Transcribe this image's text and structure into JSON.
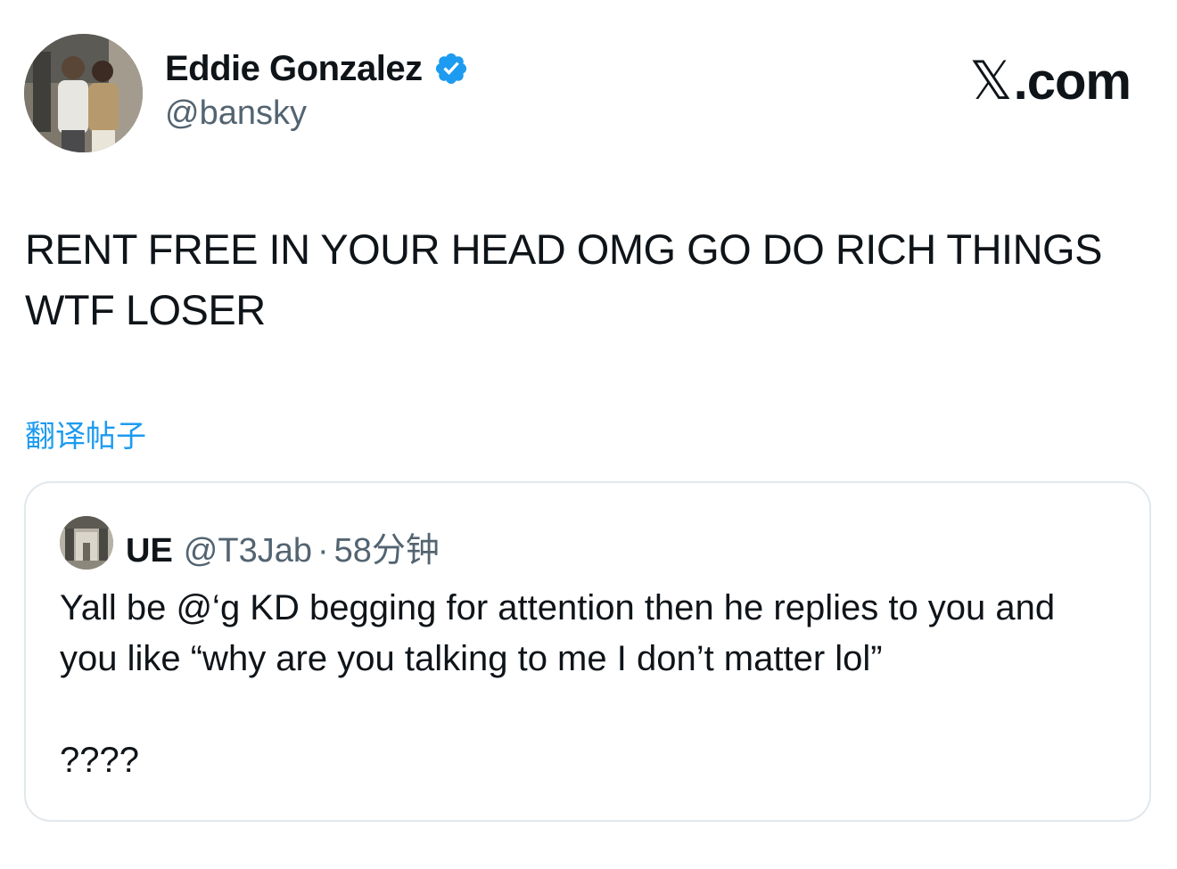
{
  "author": {
    "name": "Eddie Gonzalez",
    "handle": "@bansky",
    "verified": true,
    "avatar_icon": "profile-photo"
  },
  "brand": {
    "x_glyph": "𝕏",
    "suffix": ".com"
  },
  "tweet": {
    "text": "RENT FREE IN YOUR HEAD OMG GO DO RICH THINGS WTF LOSER",
    "translate_label": "翻译帖子"
  },
  "quote": {
    "name": "UE",
    "handle": "@T3Jab",
    "separator": "·",
    "time": "58分钟",
    "text": "Yall be @‘g KD begging for attention then he replies to you and you like “why are you talking to me I don’t matter lol”\n\n????"
  },
  "colors": {
    "accent": "#1d9bf0",
    "text": "#0f1419",
    "secondary": "#536471",
    "border": "#e1e8ed"
  }
}
